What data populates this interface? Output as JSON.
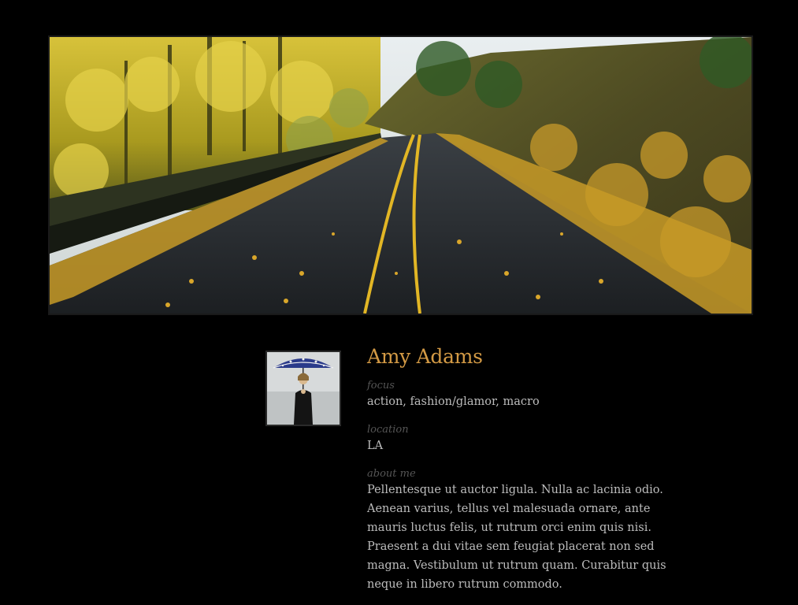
{
  "banner": {
    "image_description": "autumn road"
  },
  "profile": {
    "name": "Amy Adams",
    "fields": [
      {
        "label": "focus",
        "value": "action, fashion/glamor, macro"
      },
      {
        "label": "location",
        "value": "LA"
      },
      {
        "label": "about me",
        "value": "Pellentesque ut auctor ligula. Nulla ac lacinia odio. Aenean varius, tellus vel malesuada ornare, ante mauris luctus felis, ut rutrum orci enim quis nisi. Praesent a dui vitae sem feugiat placerat non sed magna. Vestibulum ut rutrum quam. Curabitur quis neque in libero rutrum commodo."
      }
    ]
  },
  "colors": {
    "background": "#000000",
    "name": "#d39a45",
    "label": "#555555",
    "text": "#bdbdbd"
  }
}
